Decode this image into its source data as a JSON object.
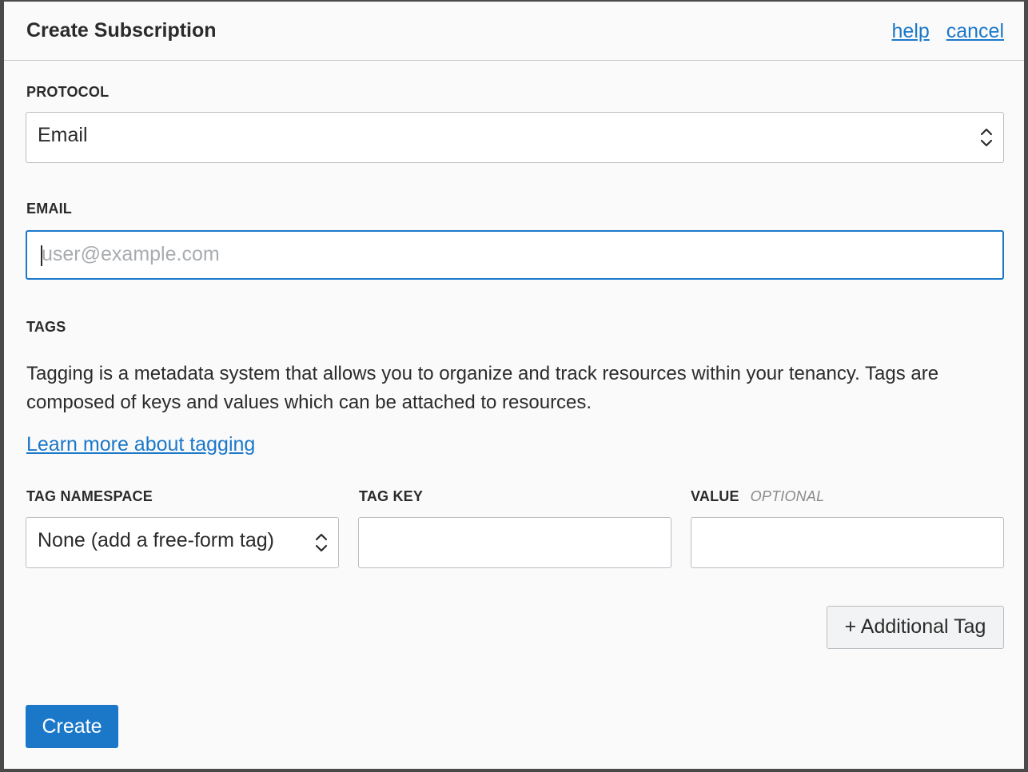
{
  "dialog": {
    "title": "Create Subscription",
    "help_link": "help",
    "cancel_link": "cancel"
  },
  "protocol": {
    "label": "PROTOCOL",
    "selected": "Email"
  },
  "email": {
    "label": "EMAIL",
    "value": "",
    "placeholder": "user@example.com"
  },
  "tags": {
    "label": "TAGS",
    "description": "Tagging is a metadata system that allows you to organize and track resources within your tenancy. Tags are composed of keys and values which can be attached to resources.",
    "learn_more_link": "Learn more about tagging",
    "namespace_label": "TAG NAMESPACE",
    "namespace_selected": "None (add a free-form tag)",
    "key_label": "TAG KEY",
    "key_value": "",
    "value_label": "VALUE",
    "value_optional": "OPTIONAL",
    "value_value": "",
    "additional_tag_button": "+ Additional Tag"
  },
  "footer": {
    "create_button": "Create"
  },
  "colors": {
    "accent": "#1b78c9",
    "border": "#b9bec3",
    "dialog_bg": "#fafafa"
  }
}
